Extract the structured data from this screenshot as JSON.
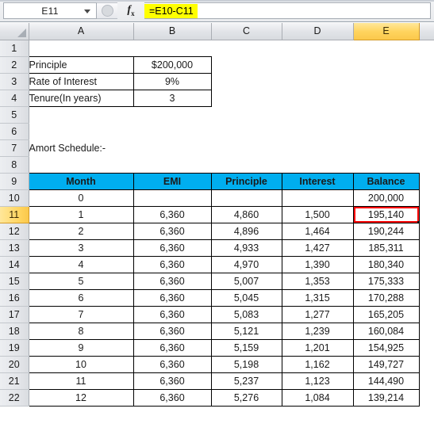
{
  "formula_bar": {
    "name_box_value": "E11",
    "name_box_dropdown_icon": "chevron-down-icon",
    "cancel_enter_icon": "circle-icon",
    "fx_label": "fx",
    "formula_value": "=E10-C11"
  },
  "grid": {
    "column_headers": [
      "A",
      "B",
      "C",
      "D",
      "E"
    ],
    "selected_column": "E",
    "selected_row": "11",
    "active_cell": "E11",
    "row_numbers": [
      "1",
      "2",
      "3",
      "4",
      "5",
      "6",
      "7",
      "8",
      "9",
      "10",
      "11",
      "12",
      "13",
      "14",
      "15",
      "16",
      "17",
      "18",
      "19",
      "20",
      "21",
      "22"
    ],
    "colors": {
      "table_header_fill": "#00AEEF",
      "selection_outline": "#FF0000",
      "selected_header_fill": "#FFD45E",
      "formula_highlight": "#FFFF00"
    }
  },
  "inputs_table": {
    "rows": [
      {
        "label": "Principle",
        "value": "$200,000"
      },
      {
        "label": "Rate of Interest",
        "value": "9%"
      },
      {
        "label": "Tenure(In years)",
        "value": "3"
      }
    ]
  },
  "section_title": "Amort Schedule:-",
  "amort_table": {
    "headers": [
      "Month",
      "EMI",
      "Principle",
      "Interest",
      "Balance"
    ],
    "rows": [
      {
        "month": "0",
        "emi": "",
        "principle": "",
        "interest": "",
        "balance": "200,000"
      },
      {
        "month": "1",
        "emi": "6,360",
        "principle": "4,860",
        "interest": "1,500",
        "balance": "195,140"
      },
      {
        "month": "2",
        "emi": "6,360",
        "principle": "4,896",
        "interest": "1,464",
        "balance": "190,244"
      },
      {
        "month": "3",
        "emi": "6,360",
        "principle": "4,933",
        "interest": "1,427",
        "balance": "185,311"
      },
      {
        "month": "4",
        "emi": "6,360",
        "principle": "4,970",
        "interest": "1,390",
        "balance": "180,340"
      },
      {
        "month": "5",
        "emi": "6,360",
        "principle": "5,007",
        "interest": "1,353",
        "balance": "175,333"
      },
      {
        "month": "6",
        "emi": "6,360",
        "principle": "5,045",
        "interest": "1,315",
        "balance": "170,288"
      },
      {
        "month": "7",
        "emi": "6,360",
        "principle": "5,083",
        "interest": "1,277",
        "balance": "165,205"
      },
      {
        "month": "8",
        "emi": "6,360",
        "principle": "5,121",
        "interest": "1,239",
        "balance": "160,084"
      },
      {
        "month": "9",
        "emi": "6,360",
        "principle": "5,159",
        "interest": "1,201",
        "balance": "154,925"
      },
      {
        "month": "10",
        "emi": "6,360",
        "principle": "5,198",
        "interest": "1,162",
        "balance": "149,727"
      },
      {
        "month": "11",
        "emi": "6,360",
        "principle": "5,237",
        "interest": "1,123",
        "balance": "144,490"
      },
      {
        "month": "12",
        "emi": "6,360",
        "principle": "5,276",
        "interest": "1,084",
        "balance": "139,214"
      }
    ]
  }
}
